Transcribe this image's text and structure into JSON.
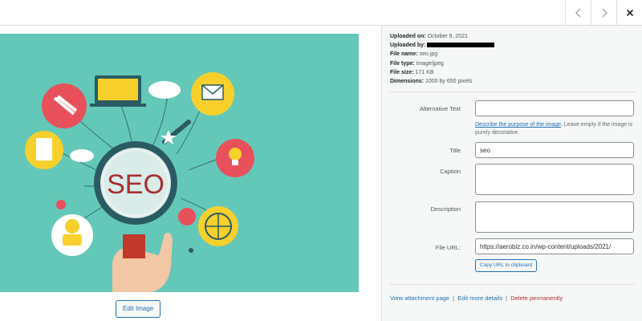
{
  "topbar": {
    "prev_icon": "chevron-left-icon",
    "next_icon": "chevron-right-icon",
    "close_icon": "close-icon"
  },
  "image": {
    "text": "SEO",
    "background_color": "#64c8b9"
  },
  "edit_image_label": "Edit Image",
  "meta": {
    "uploaded_on_label": "Uploaded on:",
    "uploaded_on": "October 9, 2021",
    "uploaded_by_label": "Uploaded by:",
    "file_name_label": "File name:",
    "file_name": "seo.jpg",
    "file_type_label": "File type:",
    "file_type": "image/jpeg",
    "file_size_label": "File size:",
    "file_size": "171 KB",
    "dimensions_label": "Dimensions:",
    "dimensions": "1000 by 650 pixels"
  },
  "form": {
    "alt_text_label": "Alternative Text",
    "alt_text_value": "",
    "help_link": "Describe the purpose of the image",
    "help_rest": ". Leave empty if the image is purely decorative.",
    "title_label": "Title",
    "title_value": "seo",
    "caption_label": "Caption",
    "caption_value": "",
    "description_label": "Description",
    "description_value": "",
    "file_url_label": "File URL:",
    "file_url_value": "https://aerobiz.co.in/wp-content/uploads/2021/",
    "copy_url_label": "Copy URL to clipboard"
  },
  "links": {
    "view_attachment": "View attachment page",
    "separator": "|",
    "edit_details": "Edit more details",
    "delete": "Delete permanently"
  },
  "colors": {
    "link": "#2271b1",
    "delete": "#b32d2e"
  }
}
